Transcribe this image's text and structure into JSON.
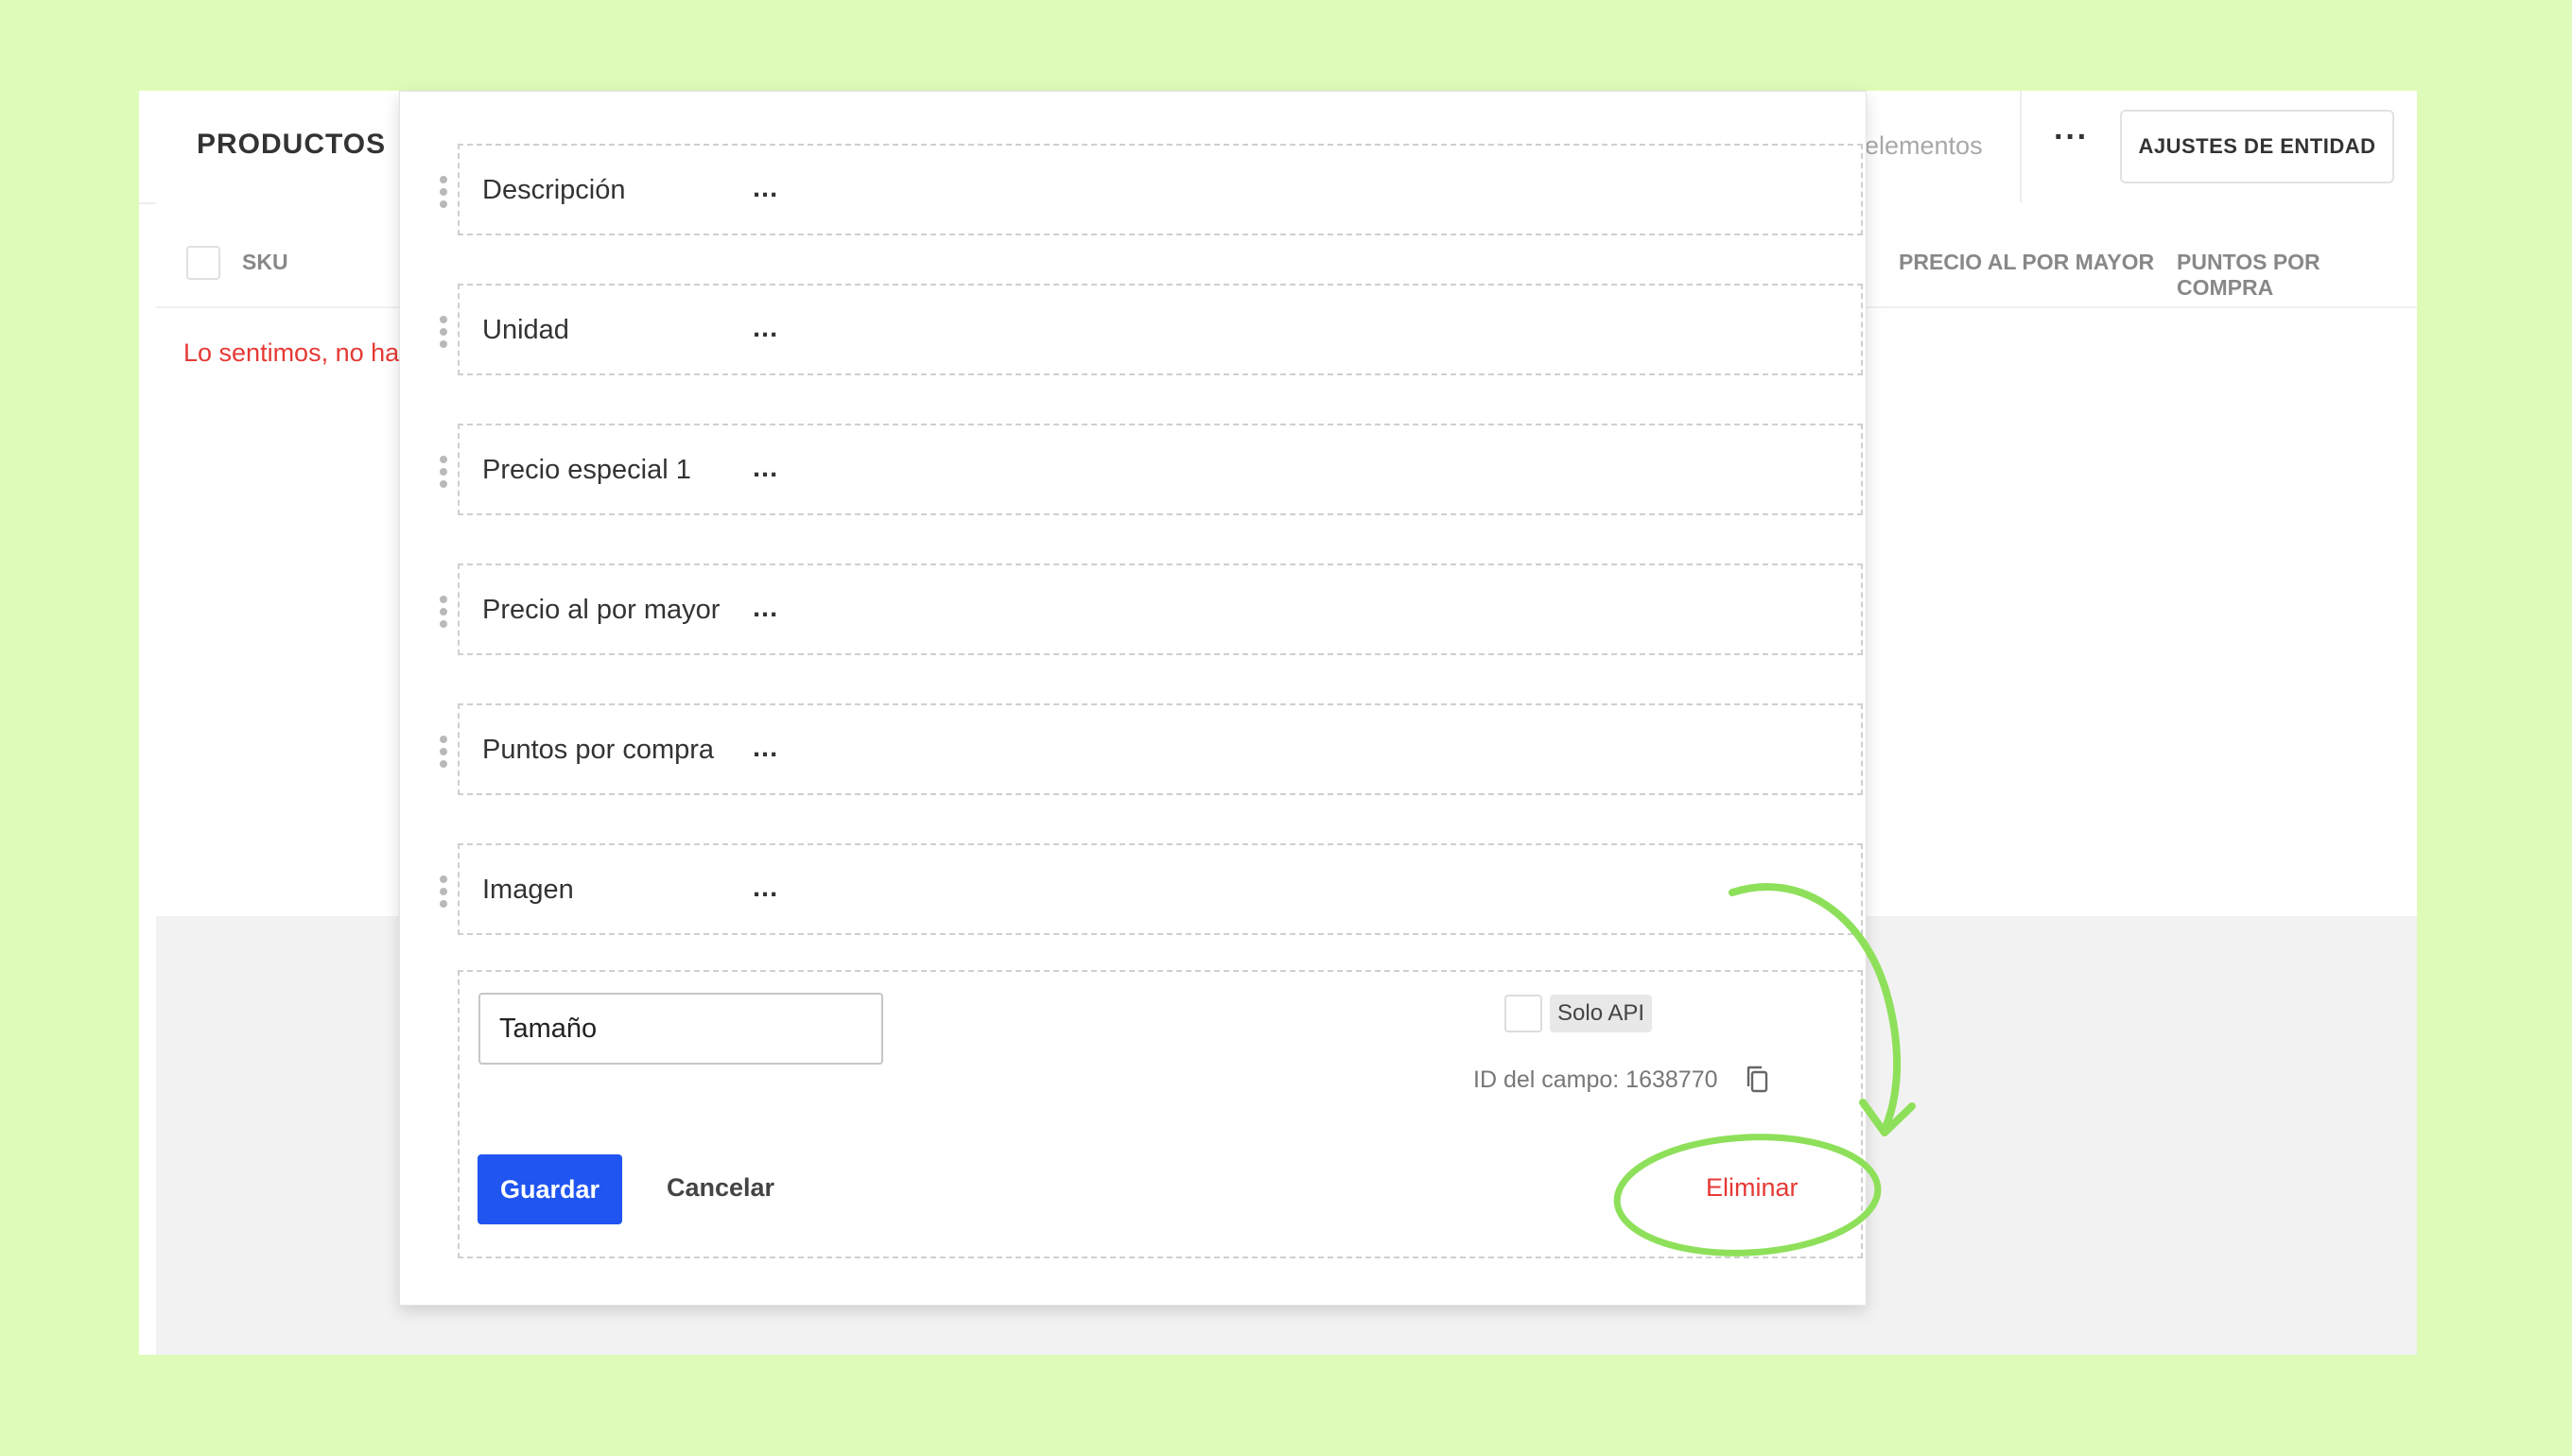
{
  "app": {
    "title": "PRODUCTOS",
    "items_label": "elementos",
    "more_label": "···",
    "entity_settings_label": "AJUSTES DE ENTIDAD"
  },
  "list": {
    "columns": [
      "SKU",
      "PRECIO AL POR MAYOR",
      "PUNTOS POR COMPRA"
    ],
    "empty_message": "Lo sentimos, no ha"
  },
  "modal": {
    "fields": [
      {
        "name": "Descripción",
        "value": "..."
      },
      {
        "name": "Unidad",
        "value": "..."
      },
      {
        "name": "Precio especial 1",
        "value": "..."
      },
      {
        "name": "Precio al por mayor",
        "value": "..."
      },
      {
        "name": "Puntos por compra",
        "value": "..."
      },
      {
        "name": "Imagen",
        "value": "..."
      }
    ],
    "editor": {
      "name_value": "Tamaño",
      "api_only_label": "Solo API",
      "field_id_text": "ID del campo: 1638770",
      "save_label": "Guardar",
      "cancel_label": "Cancelar",
      "delete_label": "Eliminar"
    }
  },
  "colors": {
    "background": "#dffbb9",
    "primary": "#2055f2",
    "danger": "#e53935",
    "annotation": "#8ee05a"
  },
  "icons": [
    "drag-handle-icon",
    "copy-icon"
  ]
}
